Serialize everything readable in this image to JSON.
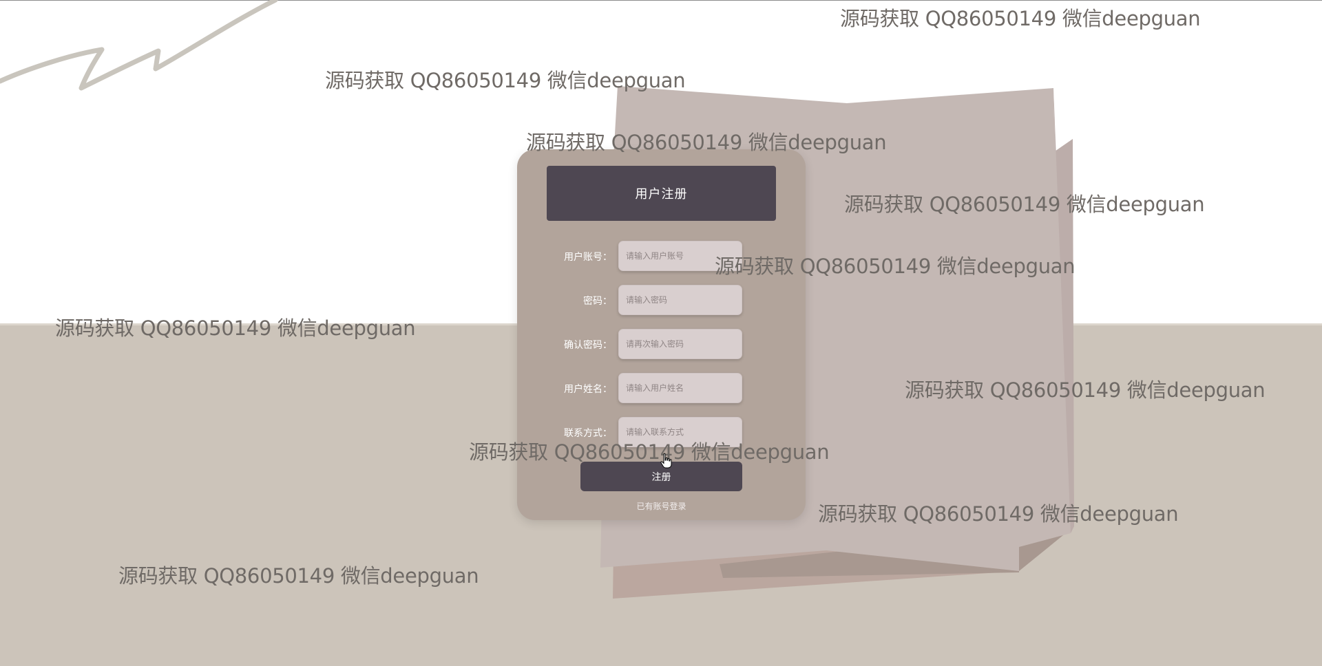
{
  "form": {
    "title": "用户注册",
    "fields": [
      {
        "label": "用户账号：",
        "placeholder": "请输入用户账号"
      },
      {
        "label": "密码：",
        "placeholder": "请输入密码"
      },
      {
        "label": "确认密码：",
        "placeholder": "请再次输入密码"
      },
      {
        "label": "用户姓名：",
        "placeholder": "请输入用户姓名"
      },
      {
        "label": "联系方式：",
        "placeholder": "请输入联系方式"
      }
    ],
    "submit_label": "注册",
    "login_link": "已有账号登录"
  },
  "watermarks": [
    "源码获取 QQ86050149 微信deepguan",
    "源码获取 QQ86050149 微信deepguan",
    "源码获取 QQ86050149 微信deepguan",
    "源码获取 QQ86050149 微信deepguan",
    "源码获取 QQ86050149 微信deepguan",
    "源码获取 QQ86050149 微信deepguan",
    "源码获取 QQ86050149 微信deepguan",
    "源码获取 QQ86050149 微信deepguan",
    "源码获取 QQ86050149 微信deepguan",
    "源码获取 QQ86050149 微信deepguan"
  ],
  "colors": {
    "card": "#b2a49b",
    "header": "#4e4752",
    "floor": "#ccc4ba",
    "input": "#d9cfcf",
    "watermark": "#6f6a66"
  }
}
